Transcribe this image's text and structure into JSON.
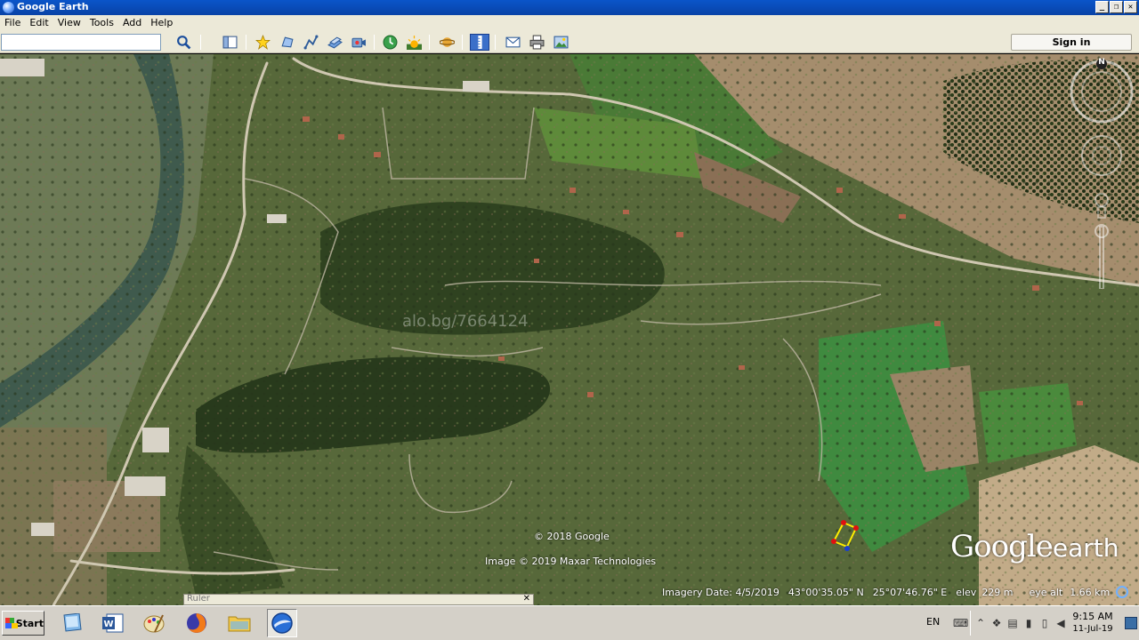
{
  "window": {
    "title": "Google Earth",
    "min": "_",
    "max": "❐",
    "close": "✕"
  },
  "menu": [
    "File",
    "Edit",
    "View",
    "Tools",
    "Add",
    "Help"
  ],
  "toolbar": {
    "search_value": "",
    "signin_label": "Sign in",
    "icons": [
      "search-icon",
      "sidebar-toggle-icon",
      "placemark-icon",
      "polygon-icon",
      "path-icon",
      "image-overlay-icon",
      "record-tour-icon",
      "historical-imagery-icon",
      "sunlight-icon",
      "planets-icon",
      "ruler-icon",
      "email-icon",
      "print-icon",
      "save-image-icon"
    ]
  },
  "map": {
    "watermark": "alo.bg/7664124",
    "copyright_google": "© 2018 Google",
    "copyright_imagery": "Image © 2019 Maxar Technologies",
    "logo_word1": "Google",
    "logo_word2": "earth",
    "imagery_date": "Imagery Date: 4/5/2019",
    "latitude": "43°00'35.05\" N",
    "longitude": "25°07'46.76\" E",
    "elev_label": "elev",
    "elev_value": "229 m",
    "eye_label": "eye alt",
    "eye_value": "1.66 km",
    "compass_north": "N",
    "colors": {
      "road": "#c8c2b0",
      "field": "#a08a6a",
      "forest": "#2d3d1c",
      "river": "#3c5a4a",
      "polygon": "#ffee00",
      "vertex": "#e01010"
    }
  },
  "ruler": {
    "title": "Ruler",
    "close": "✕"
  },
  "taskbar": {
    "start_label": "Start",
    "apps": [
      "desktop-icon",
      "word-icon",
      "paint-icon",
      "firefox-icon",
      "explorer-folder-icon",
      "google-earth-icon"
    ],
    "lang": "EN",
    "time": "9:15 AM",
    "date": "11-Jul-19"
  }
}
